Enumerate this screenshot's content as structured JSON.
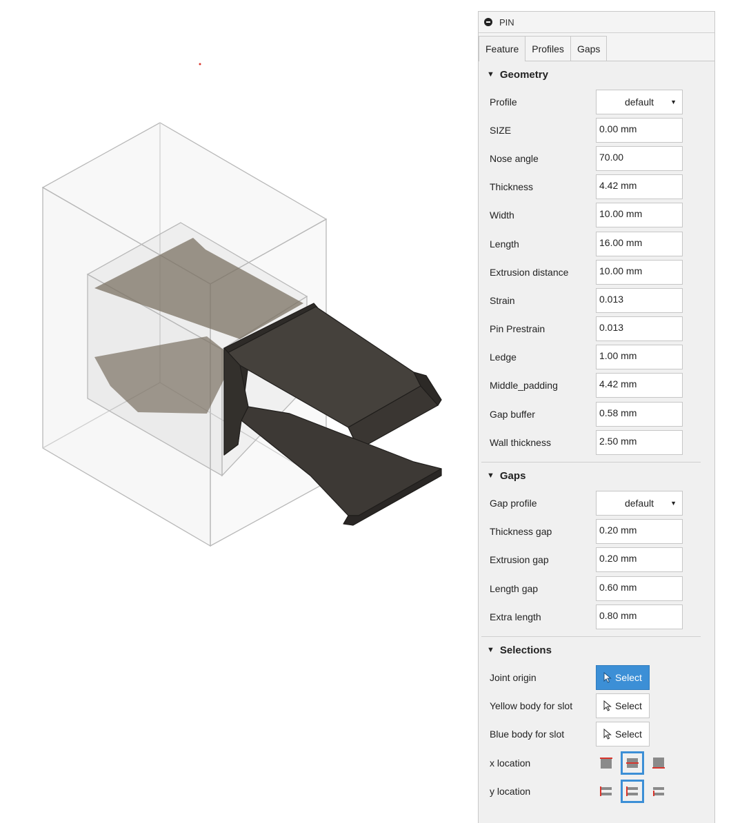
{
  "panel": {
    "title": "PIN",
    "tabs": [
      "Feature",
      "Profiles",
      "Gaps"
    ],
    "active_tab": "Feature"
  },
  "geometry": {
    "heading": "Geometry",
    "profile": {
      "label": "Profile",
      "value": "default"
    },
    "fields": [
      {
        "label": "SIZE",
        "value": "0.00 mm"
      },
      {
        "label": "Nose angle",
        "value": "70.00"
      },
      {
        "label": "Thickness",
        "value": "4.42 mm"
      },
      {
        "label": "Width",
        "value": "10.00 mm"
      },
      {
        "label": "Length",
        "value": "16.00 mm"
      },
      {
        "label": "Extrusion distance",
        "value": "10.00 mm"
      },
      {
        "label": "Strain",
        "value": "0.013"
      },
      {
        "label": "Pin Prestrain",
        "value": "0.013"
      },
      {
        "label": "Ledge",
        "value": "1.00 mm"
      },
      {
        "label": "Middle_padding",
        "value": "4.42 mm"
      },
      {
        "label": "Gap buffer",
        "value": "0.58 mm"
      },
      {
        "label": "Wall thickness",
        "value": "2.50 mm"
      }
    ]
  },
  "gaps": {
    "heading": "Gaps",
    "profile": {
      "label": "Gap profile",
      "value": "default"
    },
    "fields": [
      {
        "label": "Thickness gap",
        "value": "0.20 mm"
      },
      {
        "label": "Extrusion gap",
        "value": "0.20 mm"
      },
      {
        "label": "Length gap",
        "value": "0.60 mm"
      },
      {
        "label": "Extra length",
        "value": "0.80 mm"
      }
    ]
  },
  "selections": {
    "heading": "Selections",
    "items": [
      {
        "label": "Joint origin",
        "button": "Select",
        "active": true
      },
      {
        "label": "Yellow body for slot",
        "button": "Select",
        "active": false
      },
      {
        "label": "Blue body for slot",
        "button": "Select",
        "active": false
      }
    ],
    "x_location": {
      "label": "x location",
      "options": [
        "top-edge-icon",
        "center-line-icon",
        "bottom-edge-icon"
      ],
      "selected": 1
    },
    "y_location": {
      "label": "y location",
      "options": [
        "left-align-icon",
        "center-align-icon",
        "right-align-icon"
      ],
      "selected": 1
    }
  },
  "colors": {
    "accent": "#3c8fd6",
    "pin_body": "#3b3834",
    "ghost_body": "#7a7064",
    "location_marker": "#d9342b"
  }
}
